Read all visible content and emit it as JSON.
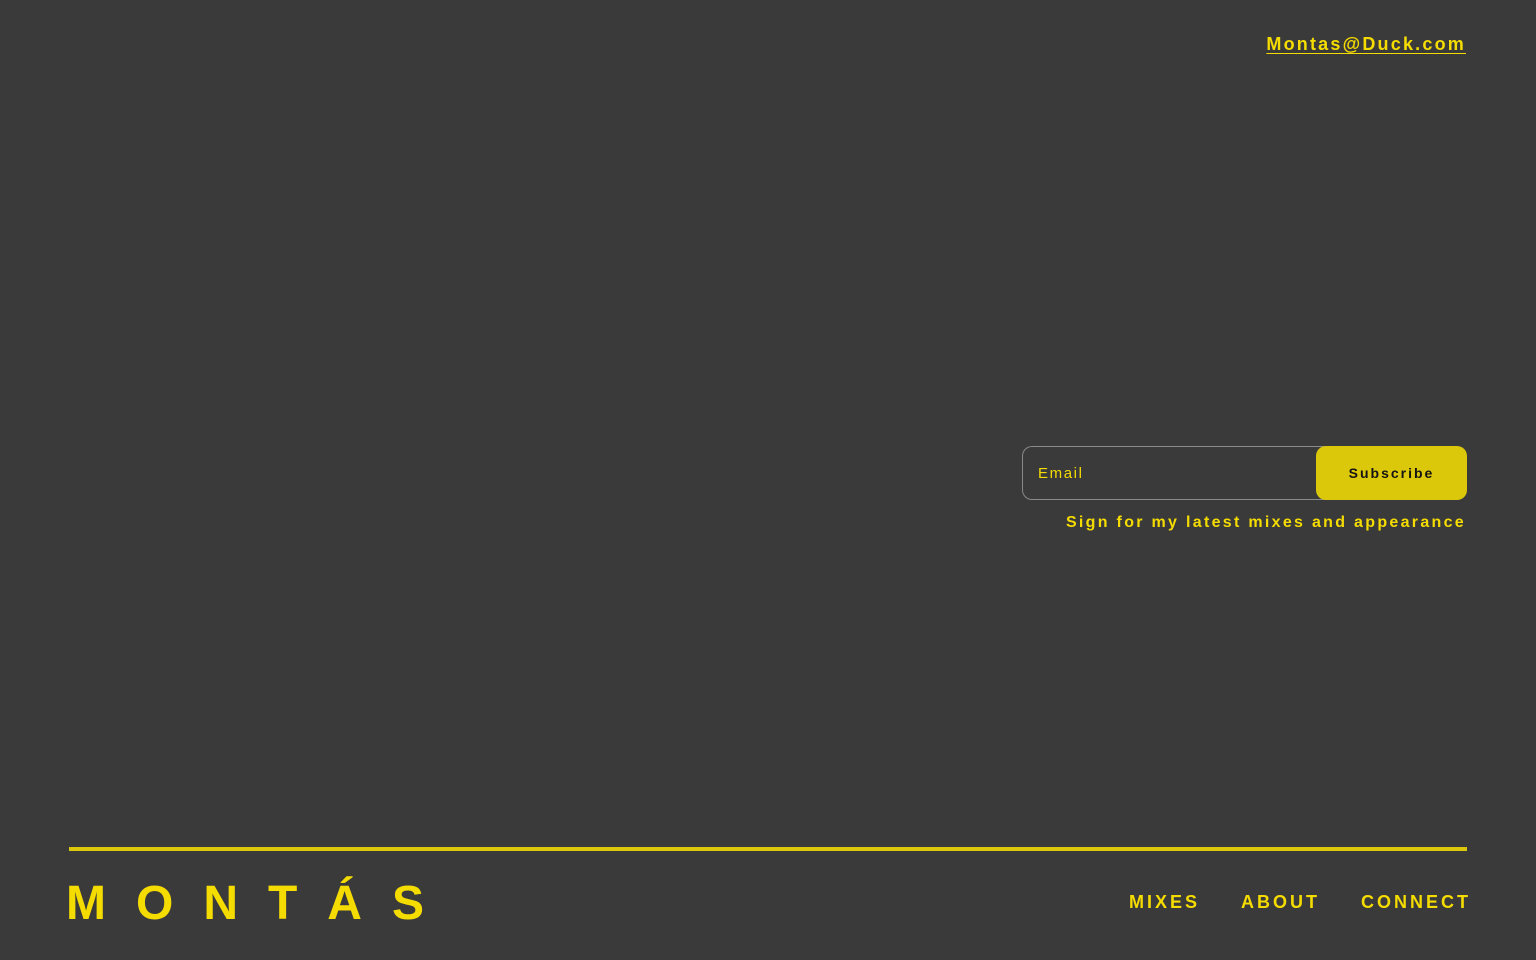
{
  "header": {
    "email": "Montas@Duck.com"
  },
  "subscribe": {
    "email_placeholder": "Email",
    "button_label": "Subscribe",
    "note": "Sign for my latest mixes and appearance"
  },
  "footer": {
    "logo": "MONTÁS",
    "nav": [
      {
        "label": "MIXES"
      },
      {
        "label": "ABOUT"
      },
      {
        "label": "CONNECT"
      }
    ]
  },
  "colors": {
    "background": "#3a3a3a",
    "accent": "#f5dc00",
    "button": "#dcc80a"
  }
}
